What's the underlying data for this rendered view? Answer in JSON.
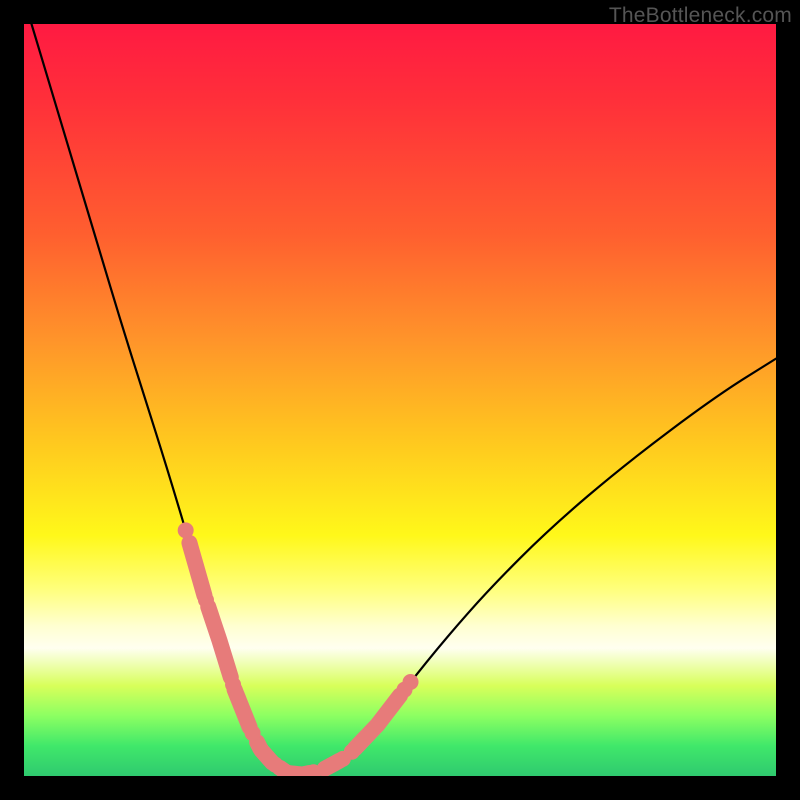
{
  "watermark": "TheBottleneck.com",
  "colors": {
    "gradient_top": "#ff1a42",
    "gradient_bottom": "#2fca6f",
    "curve": "#000000",
    "markers": "#e77b7a",
    "frame": "#000000"
  },
  "chart_data": {
    "type": "line",
    "title": "",
    "xlabel": "",
    "ylabel": "",
    "xlim": [
      0,
      100
    ],
    "ylim": [
      0,
      100
    ],
    "grid": false,
    "series": [
      {
        "name": "bottleneck-curve",
        "x": [
          1,
          4,
          7,
          10,
          13,
          16,
          19,
          22,
          24,
          26,
          28,
          30,
          31.5,
          33,
          35,
          37,
          39.5,
          43,
          47,
          51,
          56,
          62,
          70,
          80,
          92,
          100
        ],
        "y": [
          100,
          90,
          80,
          70,
          60,
          50.5,
          41,
          31,
          24,
          18,
          11.5,
          6.5,
          3.5,
          1.8,
          0.4,
          0.2,
          0.7,
          2.6,
          6.8,
          12,
          18.2,
          25,
          33,
          41.5,
          50.5,
          55.5
        ]
      }
    ],
    "annotations": {
      "highlighted_segments": [
        {
          "x_range": [
            22.0,
            24.0
          ]
        },
        {
          "x_range": [
            24.5,
            27.5
          ]
        },
        {
          "x_range": [
            28.0,
            30.0
          ]
        },
        {
          "x_range": [
            31.0,
            33.0
          ]
        },
        {
          "x_range": [
            34.0,
            38.0
          ]
        },
        {
          "x_range": [
            40.0,
            42.0
          ]
        },
        {
          "x_range": [
            44.0,
            50.0
          ]
        }
      ],
      "highlighted_dots": [
        {
          "x": 21.5
        },
        {
          "x": 24.2
        },
        {
          "x": 27.8
        },
        {
          "x": 30.4
        },
        {
          "x": 33.4
        },
        {
          "x": 38.5
        },
        {
          "x": 42.4
        },
        {
          "x": 43.6
        },
        {
          "x": 50.6
        },
        {
          "x": 51.4
        }
      ]
    }
  }
}
